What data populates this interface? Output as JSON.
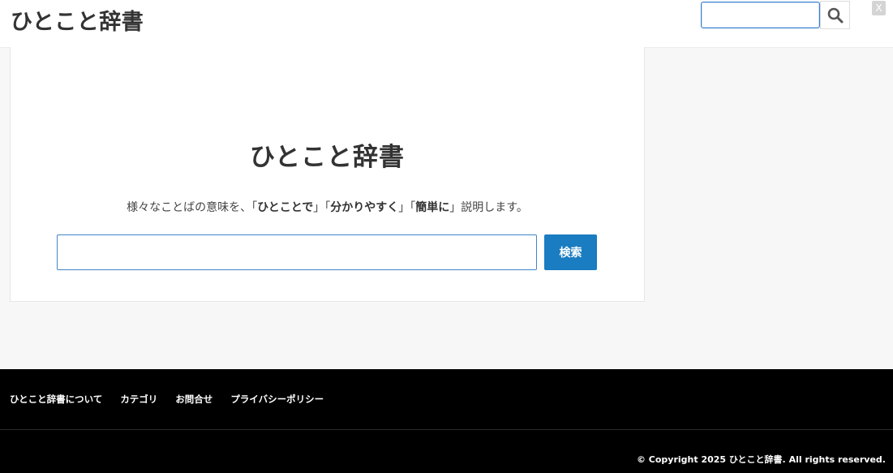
{
  "header": {
    "logo": "ひとこと辞書",
    "search_placeholder": "",
    "search_icon": "search-icon",
    "social_icon": "x-icon",
    "social_glyph": "X"
  },
  "main": {
    "title": "ひとこと辞書",
    "tagline_prefix": "様々なことばの意味を、「",
    "tagline_bold1": "ひとことで",
    "tagline_sep1": "」「",
    "tagline_bold2": "分かりやすく",
    "tagline_sep2": "」「",
    "tagline_bold3": "簡単に",
    "tagline_suffix": "」説明します。",
    "search_placeholder": "",
    "search_button": "検索",
    "accent_color": "#1a7cc1"
  },
  "footer": {
    "nav": [
      "ひとこと辞書について",
      "カテゴリ",
      "お問合せ",
      "プライバシーポリシー"
    ],
    "copyright": "© Copyright 2025 ひとこと辞書. All rights reserved."
  }
}
